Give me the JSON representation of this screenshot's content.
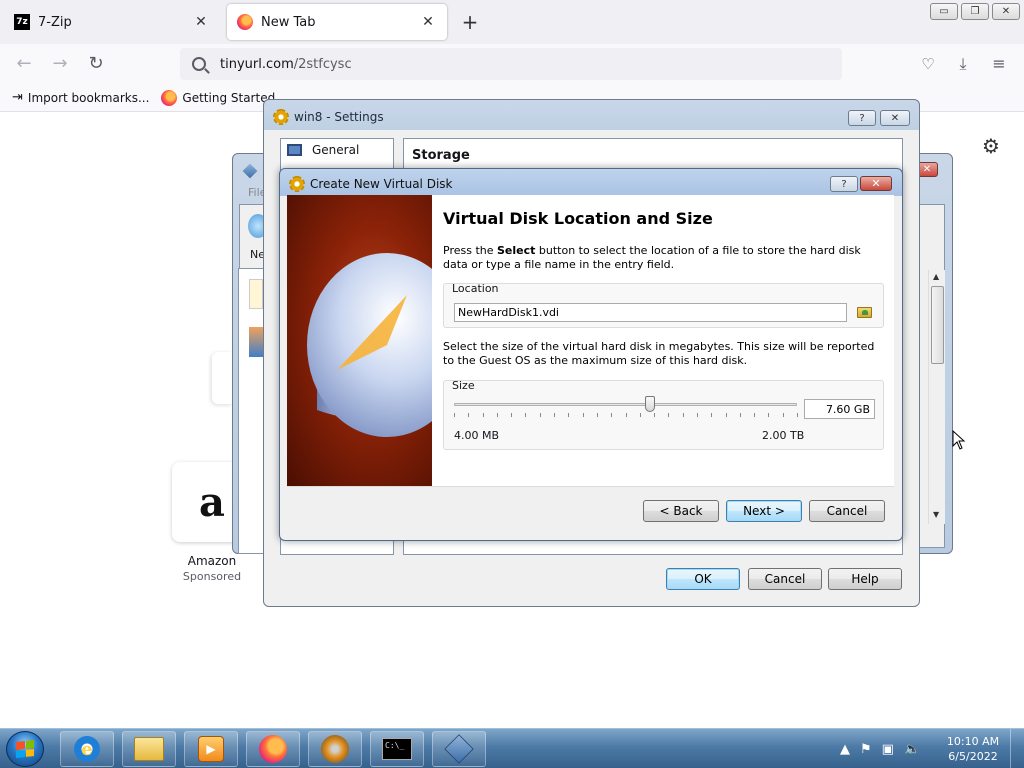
{
  "browser": {
    "tabs": [
      {
        "label": "7-Zip",
        "icon": "7zip-icon"
      },
      {
        "label": "New Tab",
        "icon": "firefox-icon"
      }
    ],
    "url_host": "tinyurl.com",
    "url_path": "/2stfcysc",
    "bookmarks": [
      {
        "label": "Import bookmarks...",
        "icon": "import-icon"
      },
      {
        "label": "Getting Started",
        "icon": "firefox-icon"
      }
    ],
    "window_buttons": {
      "minimize": "▭",
      "restore": "❐",
      "close": "✕"
    }
  },
  "newtab": {
    "shortcut_title": "Amazon",
    "shortcut_subtitle": "Sponsored",
    "shortcut_glyph": "a"
  },
  "manager": {
    "menu_stub": "File",
    "new_stub": "Ne"
  },
  "settings": {
    "title": "win8 - Settings",
    "nav_general": "General",
    "section_title": "Storage",
    "help_label": "?",
    "close_label": "✕",
    "ok": "OK",
    "cancel": "Cancel",
    "help": "Help"
  },
  "wizard": {
    "title": "Create New Virtual Disk",
    "heading": "Virtual Disk Location and Size",
    "desc1_prefix": "Press the ",
    "desc1_bold": "Select",
    "desc1_suffix": " button to select the location of a file to store the hard disk data or type a file name in the entry field.",
    "location_group": "Location",
    "location_value": "NewHardDisk1.vdi",
    "desc2": "Select the size of the virtual hard disk in megabytes. This size will be reported to the Guest OS as the maximum size of this hard disk.",
    "size_group": "Size",
    "size_value": "7.60 GB",
    "size_fraction": 0.57,
    "range_min": "4.00 MB",
    "range_max": "2.00 TB",
    "back": "< Back",
    "next": "Next >",
    "cancel": "Cancel",
    "help_label": "?",
    "close_label": "✕"
  },
  "taskbar": {
    "time": "10:10 AM",
    "date": "6/5/2022",
    "apps": [
      "internet-explorer-icon",
      "file-explorer-icon",
      "media-player-icon",
      "firefox-icon",
      "disc-burner-icon",
      "command-prompt-icon",
      "virtualbox-icon"
    ]
  },
  "colors": {
    "accent": "#3c7fb1",
    "title_bar": "#bfd3eb",
    "taskbar": "#4d7aa6"
  }
}
